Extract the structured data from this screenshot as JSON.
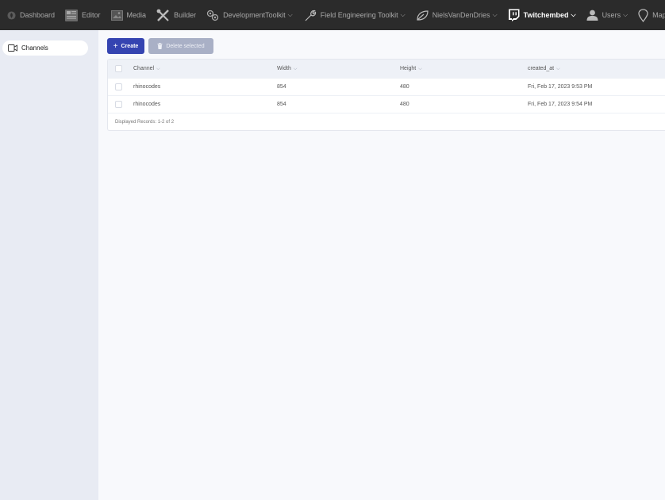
{
  "topnav": {
    "items": [
      {
        "label": "Dashboard",
        "icon": "leaf-circle-icon",
        "chevron": false
      },
      {
        "label": "Editor",
        "icon": "editor-icon",
        "chevron": false
      },
      {
        "label": "Media",
        "icon": "media-icon",
        "chevron": false
      },
      {
        "label": "Builder",
        "icon": "builder-icon",
        "chevron": false
      },
      {
        "label": "DevelopmentToolkit",
        "icon": "gears-icon",
        "chevron": true
      },
      {
        "label": "Field Engineering Toolkit",
        "icon": "wrench-icon",
        "chevron": true
      },
      {
        "label": "NielsVanDenDries",
        "icon": "leaf-icon",
        "chevron": true
      },
      {
        "label": "Twitchembed",
        "icon": "twitch-icon",
        "chevron": true,
        "active": true
      },
      {
        "label": "Users",
        "icon": "user-icon",
        "chevron": true
      },
      {
        "label": "Maps",
        "icon": "map-pin-icon",
        "chevron": false
      }
    ],
    "chevron_glyph": "⌵"
  },
  "sidebar": {
    "items": [
      {
        "label": "Channels",
        "icon": "video-camera-icon"
      }
    ]
  },
  "toolbar": {
    "create_label": "Create",
    "create_plus": "+",
    "delete_label": "Delete selected"
  },
  "table": {
    "columns": [
      {
        "label": "Channel"
      },
      {
        "label": "Width"
      },
      {
        "label": "Height"
      },
      {
        "label": "created_at"
      }
    ],
    "sort_glyph": "⌵",
    "rows": [
      {
        "channel": "rhinocodes",
        "width": "854",
        "height": "480",
        "created_at": "Fri, Feb 17, 2023 9:53 PM"
      },
      {
        "channel": "rhinocodes",
        "width": "854",
        "height": "480",
        "created_at": "Fri, Feb 17, 2023 9:54 PM"
      }
    ],
    "footer": "Displayed Records: 1-2 of 2"
  },
  "colors": {
    "nav_bg": "#2b2b2b",
    "accent": "#3544b1",
    "sidebar_bg": "#e8ebf3"
  }
}
